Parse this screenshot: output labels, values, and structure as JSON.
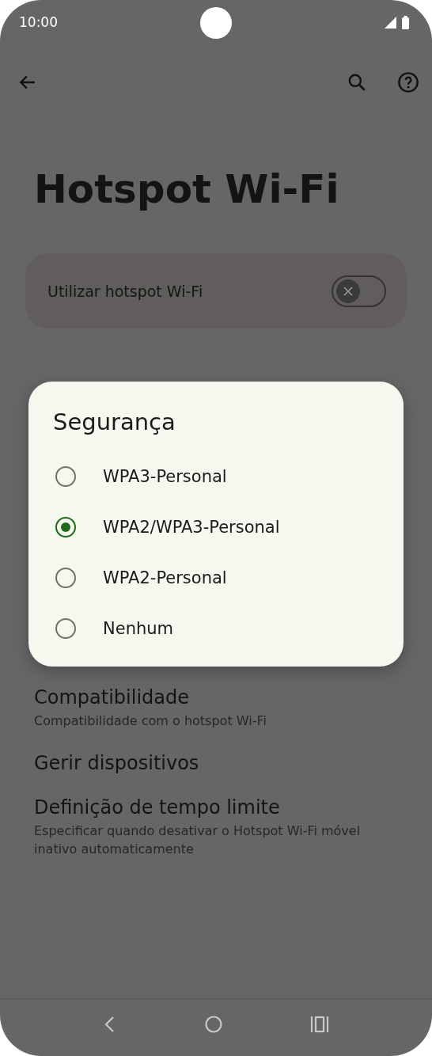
{
  "status_bar": {
    "time": "10:00"
  },
  "page_title": "Hotspot Wi-Fi",
  "hotspot_toggle": {
    "label": "Utilizar hotspot Wi-Fi",
    "on": false
  },
  "dialog": {
    "title": "Segurança",
    "options": [
      {
        "label": "WPA3-Personal",
        "selected": false
      },
      {
        "label": "WPA2/WPA3-Personal",
        "selected": true
      },
      {
        "label": "WPA2-Personal",
        "selected": false
      },
      {
        "label": "Nenhum",
        "selected": false
      }
    ]
  },
  "settings": [
    {
      "title": "Compatibilidade",
      "subtitle": "Compatibilidade com o hotspot Wi-Fi"
    },
    {
      "title": "Gerir dispositivos"
    },
    {
      "title": "Definição de tempo limite",
      "subtitle": "Especificar quando desativar o Hotspot Wi-Fi móvel inativo automaticamente"
    }
  ]
}
